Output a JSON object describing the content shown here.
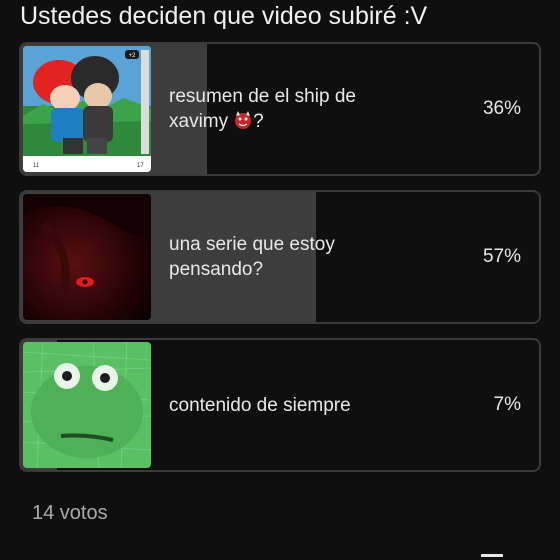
{
  "poll": {
    "question": "Ustedes deciden que video subiré :V",
    "options": [
      {
        "label": "resumen de el ship de xavimy",
        "suffix": "?",
        "percent_text": "36%",
        "percent": 36,
        "thumb": "ship-drawing"
      },
      {
        "label": "una serie que estoy pensando?",
        "percent_text": "57%",
        "percent": 57,
        "thumb": "dark-red-eye"
      },
      {
        "label": "contenido de siempre",
        "percent_text": "7%",
        "percent": 7,
        "thumb": "green-frog-math"
      }
    ],
    "votes_text": "14 votos"
  },
  "thumb1_overlay": {
    "badge": "+2",
    "like_count": "11",
    "comment_count": "17"
  },
  "colors": {
    "background": "#0f0f0f",
    "fill": "#3d3d3d",
    "border": "#3a3a3a",
    "text": "#e8e8e8",
    "muted": "#aaaaaa"
  }
}
